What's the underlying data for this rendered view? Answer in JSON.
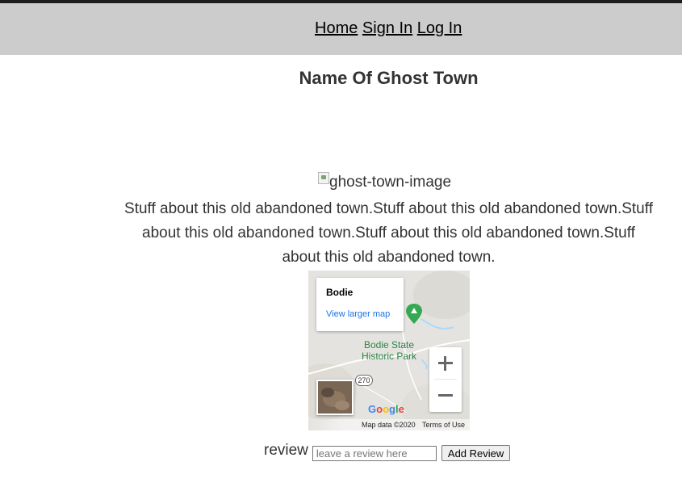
{
  "nav": {
    "home": "Home",
    "sign_in": "Sign In",
    "log_in": "Log In"
  },
  "page": {
    "title": "Name Of Ghost Town",
    "image_alt": "ghost-town-image",
    "description": "Stuff about this old abandoned town.Stuff about this old abandoned town.Stuff about this old abandoned town.Stuff about this old abandoned town.Stuff about this old abandoned town."
  },
  "map": {
    "place_name": "Bodie",
    "view_larger": "View larger map",
    "park_label": "Bodie State Historic Park",
    "route_number": "270",
    "zoom_in": "+",
    "zoom_out": "−",
    "logo_letters": [
      "G",
      "o",
      "o",
      "g",
      "l",
      "e"
    ],
    "logo_colors": [
      "#4285F4",
      "#EA4335",
      "#FBBC05",
      "#4285F4",
      "#34A853",
      "#EA4335"
    ],
    "map_data": "Map data ©2020",
    "terms": "Terms of Use",
    "marker_color": "#34a853"
  },
  "review": {
    "label": "review",
    "placeholder": "leave a review here",
    "button": "Add Review"
  }
}
